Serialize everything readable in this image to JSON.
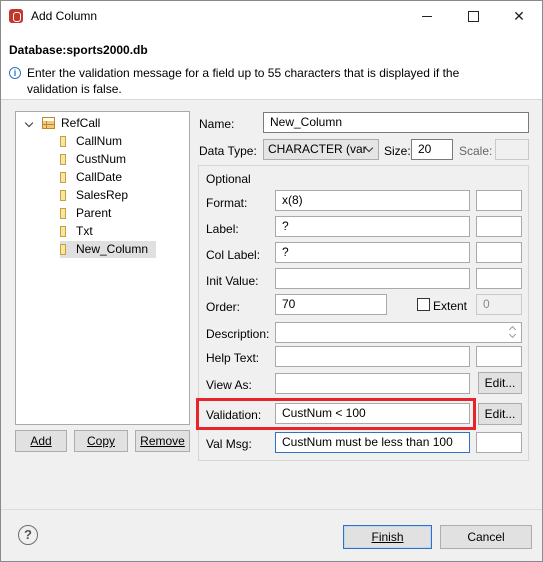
{
  "window": {
    "title": "Add Column",
    "close_symbol": "✕"
  },
  "header": {
    "database_title": "Database:sports2000.db",
    "info_message": "Enter the validation message for a field up to 55 characters that is displayed if the validation is false."
  },
  "tree": {
    "root": "RefCall",
    "children": [
      "CallNum",
      "CustNum",
      "CallDate",
      "SalesRep",
      "Parent",
      "Txt",
      "New_Column"
    ],
    "selected": "New_Column"
  },
  "tree_buttons": {
    "add": "Add",
    "copy": "Copy",
    "remove": "Remove"
  },
  "form": {
    "name_label": "Name:",
    "name_value": "New_Column",
    "data_type_label": "Data Type:",
    "data_type_value": "CHARACTER (var",
    "size_label": "Size:",
    "size_value": "20",
    "scale_label": "Scale:",
    "scale_value": "",
    "optional_label": "Optional",
    "format_label": "Format:",
    "format_value": "x(8)",
    "label_label": "Label:",
    "label_value": "?",
    "col_label_label": "Col Label:",
    "col_label_value": "?",
    "init_value_label": "Init Value:",
    "init_value_value": "",
    "order_label": "Order:",
    "order_value": "70",
    "extent_label": "Extent",
    "extent_value": "0",
    "description_label": "Description:",
    "description_value": "",
    "help_text_label": "Help Text:",
    "help_text_value": "",
    "view_as_label": "View As:",
    "view_as_value": "",
    "view_as_edit": "Edit...",
    "validation_label": "Validation:",
    "validation_value": "CustNum < 100",
    "validation_edit": "Edit...",
    "val_msg_label": "Val Msg:",
    "val_msg_value": "CustNum must be less than 100"
  },
  "footer": {
    "help_symbol": "?",
    "finish": "Finish",
    "cancel": "Cancel"
  },
  "colors": {
    "highlight": "#e8242b",
    "accent": "#2f72c4"
  }
}
